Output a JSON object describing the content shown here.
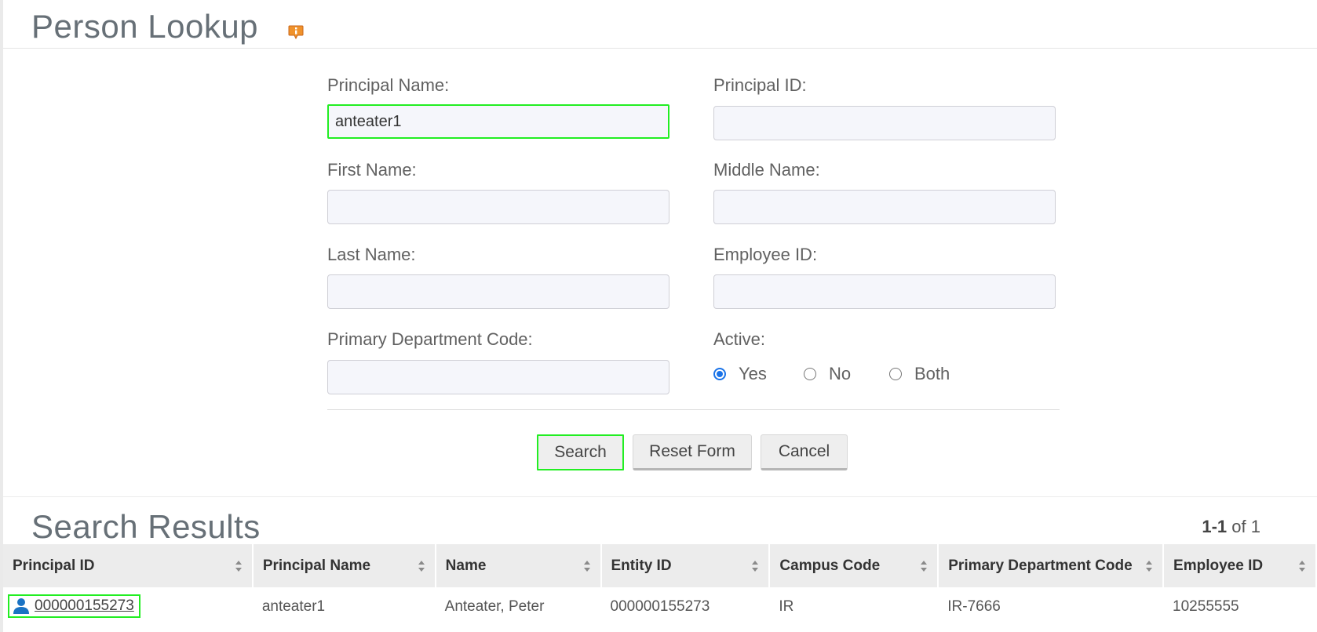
{
  "page": {
    "title": "Person Lookup"
  },
  "form": {
    "principal_name": {
      "label": "Principal Name:",
      "value": "anteater1"
    },
    "principal_id": {
      "label": "Principal ID:",
      "value": ""
    },
    "first_name": {
      "label": "First Name:",
      "value": ""
    },
    "middle_name": {
      "label": "Middle Name:",
      "value": ""
    },
    "last_name": {
      "label": "Last Name:",
      "value": ""
    },
    "employee_id": {
      "label": "Employee ID:",
      "value": ""
    },
    "primary_department_code": {
      "label": "Primary Department Code:",
      "value": ""
    },
    "active": {
      "label": "Active:",
      "options": [
        "Yes",
        "No",
        "Both"
      ],
      "selected": "Yes"
    }
  },
  "buttons": {
    "search": "Search",
    "reset": "Reset Form",
    "cancel": "Cancel"
  },
  "results": {
    "title": "Search Results",
    "pager": {
      "range": "1-1",
      "of_text": "of",
      "total": "1"
    },
    "columns": [
      "Principal ID",
      "Principal Name",
      "Name",
      "Entity ID",
      "Campus Code",
      "Primary Department Code",
      "Employee ID"
    ],
    "rows": [
      {
        "principal_id": "000000155273",
        "principal_name": "anteater1",
        "name": "Anteater, Peter",
        "entity_id": "000000155273",
        "campus_code": "IR",
        "primary_department_code": "IR-7666",
        "employee_id": "10255555"
      }
    ]
  },
  "colors": {
    "highlight": "#22ee22",
    "radio_accent": "#1a73e8",
    "help_icon": "#f0922b",
    "person_icon": "#1a73c4"
  },
  "icons": {
    "help": "help-icon",
    "sort": "sort-icon",
    "person": "person-icon"
  }
}
